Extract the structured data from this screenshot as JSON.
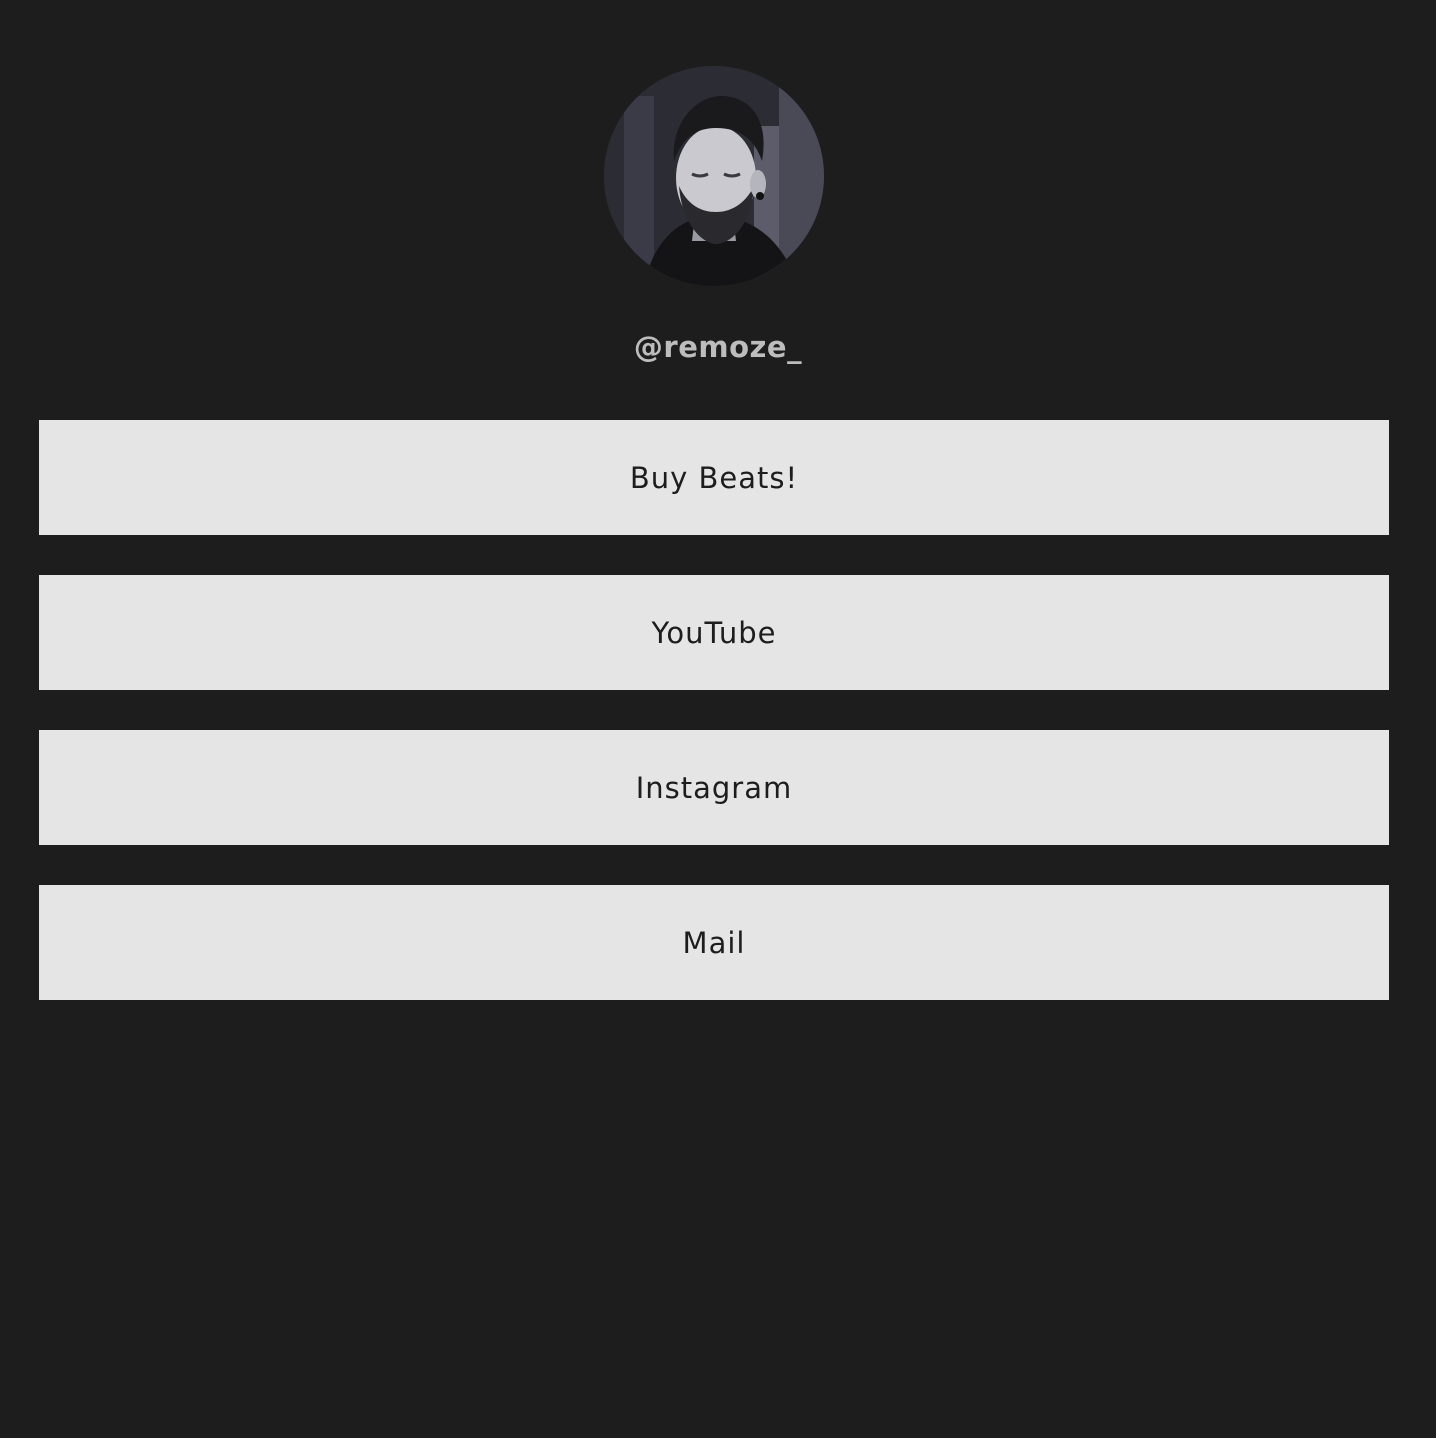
{
  "profile": {
    "username": "@remoze_",
    "avatar_icon": "profile-photo"
  },
  "colors": {
    "background": "#1d1d1d",
    "button_background": "#e5e5e5",
    "button_text": "#1d1d1d",
    "username_text": "#bdbdbd"
  },
  "links": [
    {
      "label": "Buy Beats!"
    },
    {
      "label": "YouTube"
    },
    {
      "label": "Instagram"
    },
    {
      "label": "Mail"
    }
  ]
}
